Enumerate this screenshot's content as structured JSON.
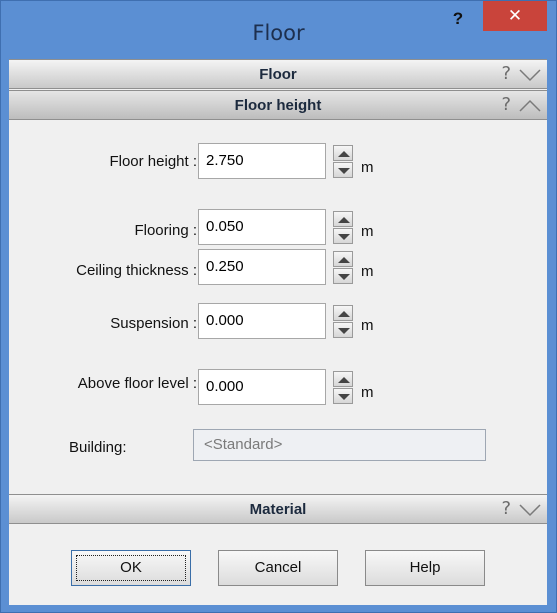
{
  "window": {
    "title": "Floor",
    "help_glyph": "?",
    "close_glyph": "✕"
  },
  "sections": {
    "floor": {
      "title": "Floor",
      "help_glyph": "?",
      "state": "collapsed"
    },
    "floor_height": {
      "title": "Floor height",
      "help_glyph": "?",
      "state": "expanded"
    },
    "material": {
      "title": "Material",
      "help_glyph": "?",
      "state": "collapsed"
    }
  },
  "fields": {
    "floor_height": {
      "label": "Floor height :",
      "value": "2.750",
      "unit": "m"
    },
    "flooring": {
      "label": "Flooring :",
      "value": "0.050",
      "unit": "m"
    },
    "ceiling_thickness": {
      "label": "Ceiling thickness :",
      "value": "0.250",
      "unit": "m"
    },
    "suspension": {
      "label": "Suspension :",
      "value": "0.000",
      "unit": "m"
    },
    "above_floor_level": {
      "label": "Above floor level :",
      "value": "0.000",
      "unit": "m"
    },
    "building": {
      "label": "Building:",
      "value": "<Standard>"
    }
  },
  "buttons": {
    "ok": "OK",
    "cancel": "Cancel",
    "help": "Help"
  },
  "colors": {
    "titlebar": "#5b8fd3",
    "close_button": "#c9443b",
    "section_title": "#1c2a3e"
  }
}
